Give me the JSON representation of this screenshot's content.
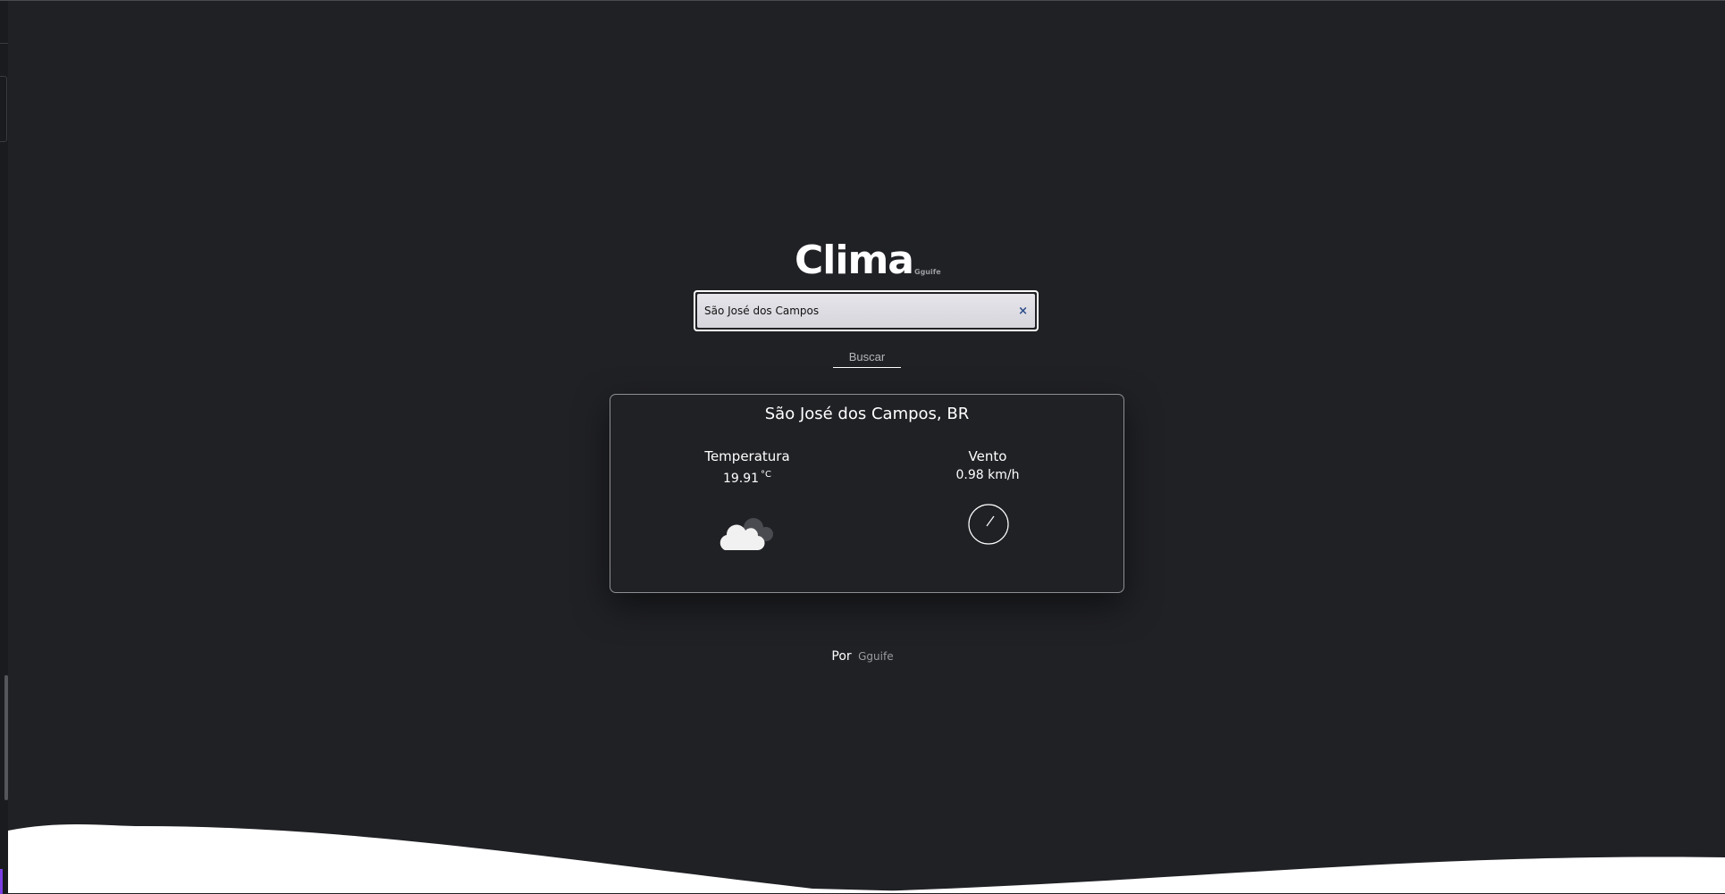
{
  "app": {
    "title": "Clima",
    "title_sub": "Gguife"
  },
  "search": {
    "value": "São José dos Campos",
    "placeholder": "",
    "clear_icon": "×",
    "button_label": "Buscar"
  },
  "weather": {
    "location": "São José dos Campos, BR",
    "temperature_label": "Temperatura",
    "temperature_value": "19.91",
    "temperature_unit": "°C",
    "weather_icon": "cloudy-icon",
    "wind_label": "Vento",
    "wind_value": "0.98 km/h",
    "wind_icon": "wind-direction-compass-icon"
  },
  "footer": {
    "prefix": "Por",
    "author": "Gguife"
  },
  "colors": {
    "background": "#202125",
    "card_border": "#8e8f94",
    "accent_blue": "#2c4d8a",
    "wave": "#ffffff"
  }
}
